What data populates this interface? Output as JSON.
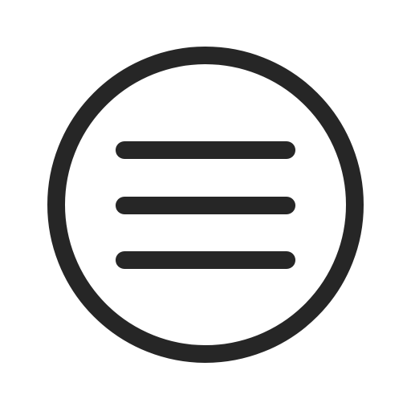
{
  "icon": {
    "name": "menu-circle-icon",
    "stroke_color": "#262626",
    "background_color": "#ffffff"
  }
}
